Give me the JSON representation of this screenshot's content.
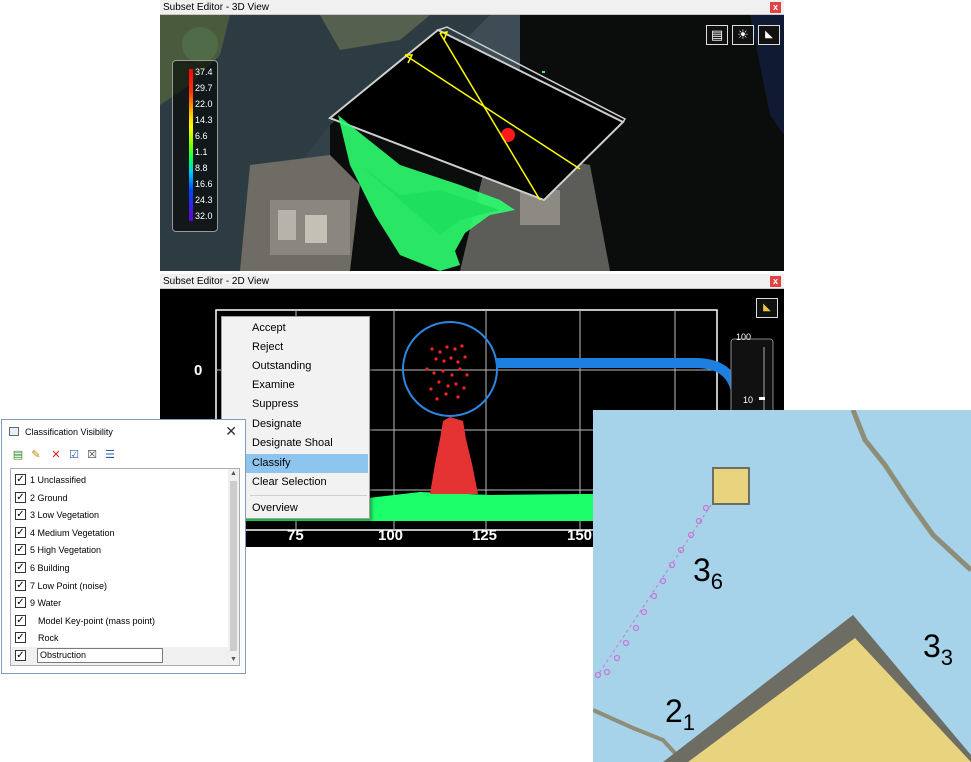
{
  "view3d": {
    "title": "Subset Editor - 3D View",
    "close_label": "x",
    "toolbar_icons": [
      "film-icon",
      "lightbulb-icon",
      "shade-icon"
    ],
    "legend": [
      "37.4",
      "29.7",
      "22.0",
      "14.3",
      "6.6",
      "1.1",
      "8.8",
      "16.6",
      "24.3",
      "32.0"
    ]
  },
  "view2d": {
    "title": "Subset Editor - 2D View",
    "close_label": "x",
    "y_tick": "0",
    "x_ticks": [
      "75",
      "100",
      "125",
      "150"
    ],
    "scale_ticks": [
      "100",
      "10"
    ],
    "toolbar_icons": [
      "shade-icon"
    ]
  },
  "context_menu": {
    "items": [
      "Accept",
      "Reject",
      "Outstanding",
      "Examine",
      "Suppress",
      "Designate",
      "Designate Shoal",
      "Classify",
      "Clear Selection",
      "Overview"
    ],
    "active": "Classify"
  },
  "classification_visibility": {
    "title": "Classification Visibility",
    "close_label": "✕",
    "toolbar": [
      "add-icon",
      "edit-icon",
      "delete-icon",
      "check-icon",
      "clear-icon",
      "export-icon"
    ],
    "items": [
      {
        "label": "1 Unclassified",
        "checked": true
      },
      {
        "label": "2 Ground",
        "checked": true
      },
      {
        "label": "3 Low Vegetation",
        "checked": true
      },
      {
        "label": "4 Medium Vegetation",
        "checked": true
      },
      {
        "label": "5 High Vegetation",
        "checked": true
      },
      {
        "label": "6 Building",
        "checked": true
      },
      {
        "label": "7 Low Point (noise)",
        "checked": true
      },
      {
        "label": "9 Water",
        "checked": true
      },
      {
        "label": "Model Key-point (mass point)",
        "checked": true
      },
      {
        "label": "Rock",
        "checked": true
      },
      {
        "label": "Obstruction",
        "checked": true
      }
    ],
    "editing_value": "Obstruction"
  },
  "chart": {
    "soundings": [
      {
        "main": "3",
        "sub": "6"
      },
      {
        "main": "3",
        "sub": "3"
      },
      {
        "main": "2",
        "sub": "1"
      }
    ],
    "colors": {
      "water": "#a6d3ea",
      "land": "#e8d37e",
      "coast": "#6d6d63",
      "point_series": "#e53333",
      "ground": "#1dff6a"
    }
  }
}
